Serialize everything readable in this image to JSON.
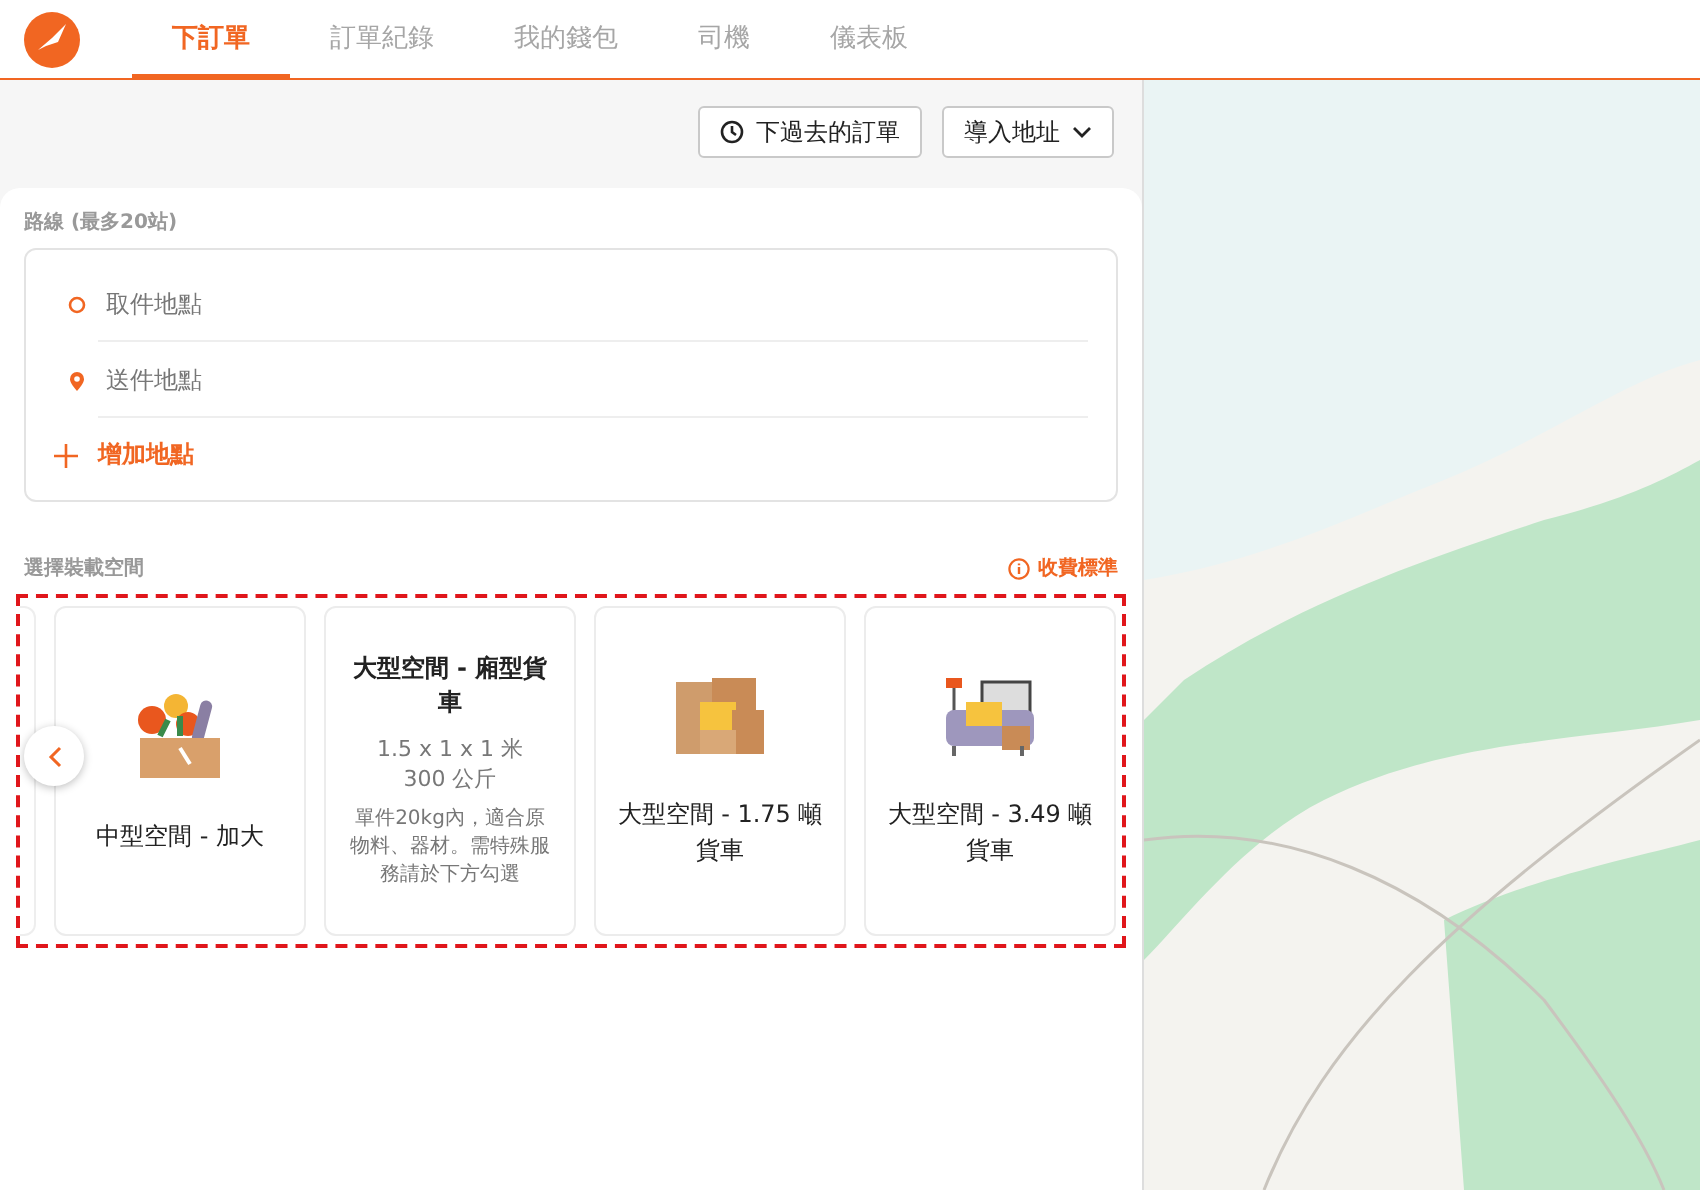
{
  "nav": {
    "tabs": [
      {
        "label": "下訂單",
        "selected": true
      },
      {
        "label": "訂單紀錄",
        "selected": false
      },
      {
        "label": "我的錢包",
        "selected": false
      },
      {
        "label": "司機",
        "selected": false
      },
      {
        "label": "儀表板",
        "selected": false
      }
    ]
  },
  "actions": [
    {
      "label": "下過去的訂單",
      "kind": "history"
    },
    {
      "label": "導入地址",
      "kind": "dropdown"
    }
  ],
  "route": {
    "title": "路線 (最多20站)",
    "stops": [
      {
        "placeholder": "取件地點",
        "kind": "pickup"
      },
      {
        "placeholder": "送件地點",
        "kind": "dropoff"
      }
    ],
    "add_label": "增加地點"
  },
  "vehicles": {
    "title": "選擇裝載空間",
    "pricing_link": "收費標準",
    "cards": [
      {
        "kind": "flowers",
        "name": "中型空間 - 加大"
      },
      {
        "kind": "detail",
        "name": "大型空間 - 廂型貨車",
        "dimensions": "1.5 x 1 x 1 米",
        "weight": "300 公斤",
        "note": "單件20kg內，適合原物料、器材。需特殊服務請於下方勾選"
      },
      {
        "kind": "boxes",
        "name": "大型空間 - 1.75 噸貨車"
      },
      {
        "kind": "furniture",
        "name": "大型空間 - 3.49 噸貨車"
      }
    ]
  }
}
